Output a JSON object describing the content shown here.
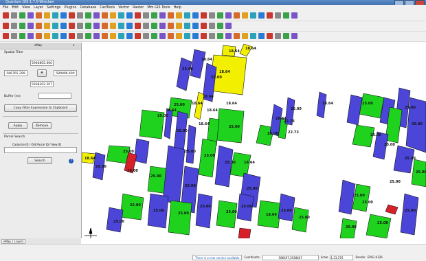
{
  "window": {
    "title": "Quantum GIS 1.7.0-Wroclaw"
  },
  "menu": [
    "File",
    "Edit",
    "View",
    "Layer",
    "Settings",
    "Plugins",
    "Database",
    "CadTools",
    "Vector",
    "Raster",
    "Mm GIS Tools",
    "Help"
  ],
  "panel": {
    "title": "eMap",
    "close_label": "x",
    "spatial_filter_label": "Spatial Filter",
    "north": "5940805.000",
    "west": "586765.299",
    "east": "589096.499",
    "south": "5938202.207",
    "center_icon": "pan-icon",
    "buffer_label": "Buffer (m):",
    "buffer_value": "",
    "copy_button": "Copy Filter Expression to Clipboard",
    "apply_button": "Apply",
    "remove_button": "Remove",
    "parcel_search_label": "Parcel Search",
    "cadastre_label": "Cadastre ID / Old Parcel ID / New ID",
    "cadastre_value": "",
    "search_button": "Search",
    "help_icon": "help-icon"
  },
  "bottom_tabs": [
    "eMap",
    "Layers"
  ],
  "statusbar": {
    "message": "There is a new version available",
    "coordinate_label": "Coordinate:",
    "coordinate_value": "586697,5938607",
    "scale_label": "Scale",
    "scale_value": "1:23,576",
    "render_label": "Render",
    "epsg": "EPSG:4326"
  },
  "map": {
    "labels": [
      "18.64",
      "18.64",
      "25.00",
      "25.00",
      "25.00",
      "25.00",
      "18.64",
      "18.64",
      "18.64",
      "25.00",
      "18.64",
      "18.64",
      "22.73",
      "22.73",
      "25.00",
      "25.00",
      "25.00",
      "18.64",
      "25.00",
      "25.00",
      "25.00",
      "25.00",
      "25.00",
      "18.64",
      "25.00",
      "18.64",
      "25.00",
      "25.00",
      "25.00",
      "25.00",
      "25.00",
      "25.00",
      "25.00",
      "18.64",
      "18.64",
      "18.64",
      "25.00",
      "25.00",
      "25.00",
      "25.00",
      "25.00",
      "25.00",
      "18.64",
      "25.00",
      "25.00",
      "25.00",
      "25.00",
      "25.00",
      "25.00",
      "18.64",
      "25.00",
      "25.00",
      "25.00",
      "25.00",
      "25.00",
      "25.00"
    ],
    "colors": {
      "green": "#1ed21e",
      "blue": "#4b45d8",
      "yellow": "#f2f000",
      "red": "#d8202a",
      "outline": "#111111"
    }
  }
}
